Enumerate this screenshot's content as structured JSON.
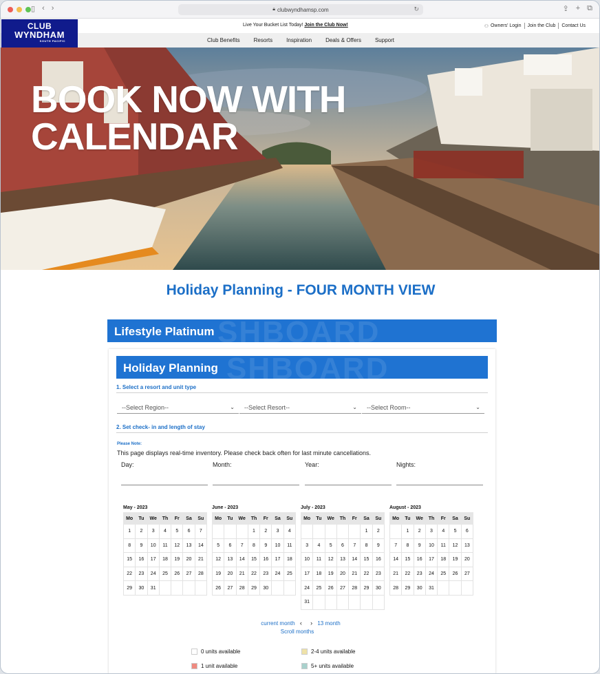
{
  "browser": {
    "url": "clubwyndhamsp.com"
  },
  "header": {
    "logo": {
      "line1": "CLUB",
      "line2": "WYNDHAM",
      "line3": "SOUTH PACIFIC"
    },
    "promo_text": "Live Your Bucket List Today! ",
    "promo_link": "Join the Club Now!",
    "top_links": [
      "Owners' Login",
      "Join the Club",
      "Contact Us"
    ],
    "nav": [
      "Club Benefits",
      "Resorts",
      "Inspiration",
      "Deals & Offers",
      "Support"
    ]
  },
  "hero": {
    "title_line1": "BOOK NOW WITH",
    "title_line2": "CALENDAR"
  },
  "page_title": "Holiday Planning - FOUR MONTH VIEW",
  "membership": "Lifestyle Platinum",
  "section_title": "Holiday Planning",
  "watermark": "SHBOARD",
  "step1": "1. Select a resort and unit type",
  "selects": {
    "region": "--Select Region--",
    "resort": "--Select Resort--",
    "room": "--Select Room--"
  },
  "step2": "2. Set check- in and length of stay",
  "note_label": "Please Note:",
  "note_text": "This page displays real-time inventory. Please check back often for last minute cancellations.",
  "fields": {
    "day": "Day:",
    "month": "Month:",
    "year": "Year:",
    "nights": "Nights:"
  },
  "weekdays": [
    "Mo",
    "Tu",
    "We",
    "Th",
    "Fr",
    "Sa",
    "Su"
  ],
  "months": [
    {
      "name": "May - 2023",
      "weeks": [
        [
          "1",
          "2",
          "3",
          "4",
          "5",
          "6",
          "7"
        ],
        [
          "8",
          "9",
          "10",
          "11",
          "12",
          "13",
          "14"
        ],
        [
          "15",
          "16",
          "17",
          "18",
          "19",
          "20",
          "21"
        ],
        [
          "22",
          "23",
          "24",
          "25",
          "26",
          "27",
          "28"
        ],
        [
          "29",
          "30",
          "31",
          "",
          "",
          "",
          ""
        ]
      ]
    },
    {
      "name": "June - 2023",
      "weeks": [
        [
          "",
          "",
          "",
          "1",
          "2",
          "3",
          "4"
        ],
        [
          "5",
          "6",
          "7",
          "8",
          "9",
          "10",
          "11"
        ],
        [
          "12",
          "13",
          "14",
          "15",
          "16",
          "17",
          "18"
        ],
        [
          "19",
          "20",
          "21",
          "22",
          "23",
          "24",
          "25"
        ],
        [
          "26",
          "27",
          "28",
          "29",
          "30",
          "",
          ""
        ]
      ]
    },
    {
      "name": "July - 2023",
      "weeks": [
        [
          "",
          "",
          "",
          "",
          "",
          "1",
          "2"
        ],
        [
          "3",
          "4",
          "5",
          "6",
          "7",
          "8",
          "9"
        ],
        [
          "10",
          "11",
          "12",
          "13",
          "14",
          "15",
          "16"
        ],
        [
          "17",
          "18",
          "19",
          "20",
          "21",
          "22",
          "23"
        ],
        [
          "24",
          "25",
          "26",
          "27",
          "28",
          "29",
          "30"
        ],
        [
          "31",
          "",
          "",
          "",
          "",
          "",
          ""
        ]
      ]
    },
    {
      "name": "August - 2023",
      "weeks": [
        [
          "",
          "1",
          "2",
          "3",
          "4",
          "5",
          "6"
        ],
        [
          "7",
          "8",
          "9",
          "10",
          "11",
          "12",
          "13"
        ],
        [
          "14",
          "15",
          "16",
          "17",
          "18",
          "19",
          "20"
        ],
        [
          "21",
          "22",
          "23",
          "24",
          "25",
          "26",
          "27"
        ],
        [
          "28",
          "29",
          "30",
          "31",
          "",
          "",
          ""
        ]
      ]
    }
  ],
  "calendar_nav": {
    "current": "current month",
    "prev": "‹",
    "next": "›",
    "range": "13 month",
    "scroll": "Scroll months"
  },
  "legend": [
    {
      "label": "0 units available",
      "color": "#ffffff"
    },
    {
      "label": "2-4 units available",
      "color": "#efe2a8"
    },
    {
      "label": "1 unit available",
      "color": "#ef8a80"
    },
    {
      "label": "5+ units available",
      "color": "#a9d1cc"
    }
  ]
}
